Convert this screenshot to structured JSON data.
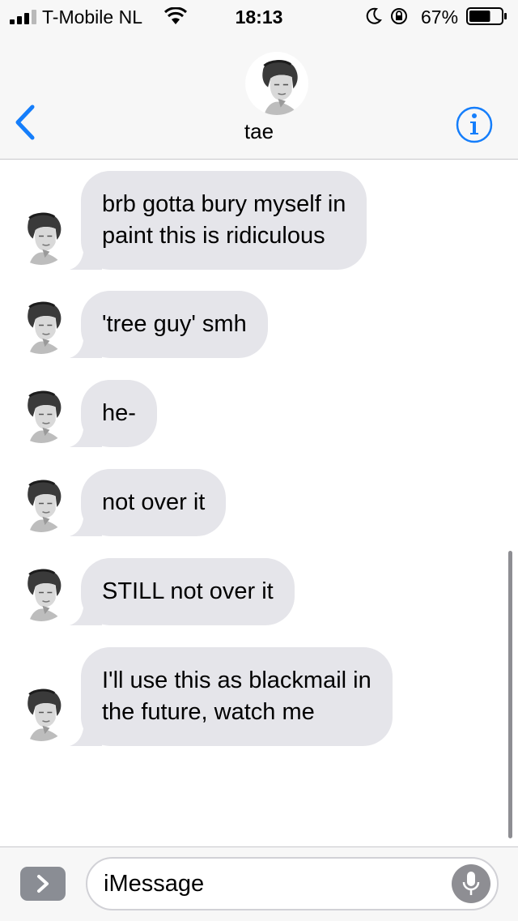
{
  "status_bar": {
    "carrier": "T-Mobile NL",
    "time": "18:13",
    "battery_percent": "67%",
    "battery_level": 0.67,
    "icons": [
      "signal-icon",
      "wifi-icon",
      "moon-icon",
      "rotation-lock-icon",
      "battery-icon"
    ]
  },
  "header": {
    "contact_name": "tae",
    "icons": [
      "back-chevron-icon",
      "contact-avatar",
      "info-icon"
    ]
  },
  "messages": [
    {
      "sender": "tae",
      "direction": "incoming",
      "lines": [
        "brb gotta bury myself in",
        "paint this is ridiculous"
      ]
    },
    {
      "sender": "tae",
      "direction": "incoming",
      "lines": [
        "'tree guy' smh"
      ]
    },
    {
      "sender": "tae",
      "direction": "incoming",
      "lines": [
        "he-"
      ]
    },
    {
      "sender": "tae",
      "direction": "incoming",
      "lines": [
        "not over it"
      ]
    },
    {
      "sender": "tae",
      "direction": "incoming",
      "lines": [
        "STILL not over it"
      ]
    },
    {
      "sender": "tae",
      "direction": "incoming",
      "lines": [
        "I'll use this as blackmail in",
        "the future, watch me"
      ]
    }
  ],
  "input_bar": {
    "placeholder": "iMessage",
    "icons": [
      "apps-chevron-icon",
      "microphone-icon"
    ]
  },
  "colors": {
    "accent_blue": "#157efb",
    "incoming_bubble": "#e5e5ea",
    "bar_background": "#f7f7f7"
  }
}
